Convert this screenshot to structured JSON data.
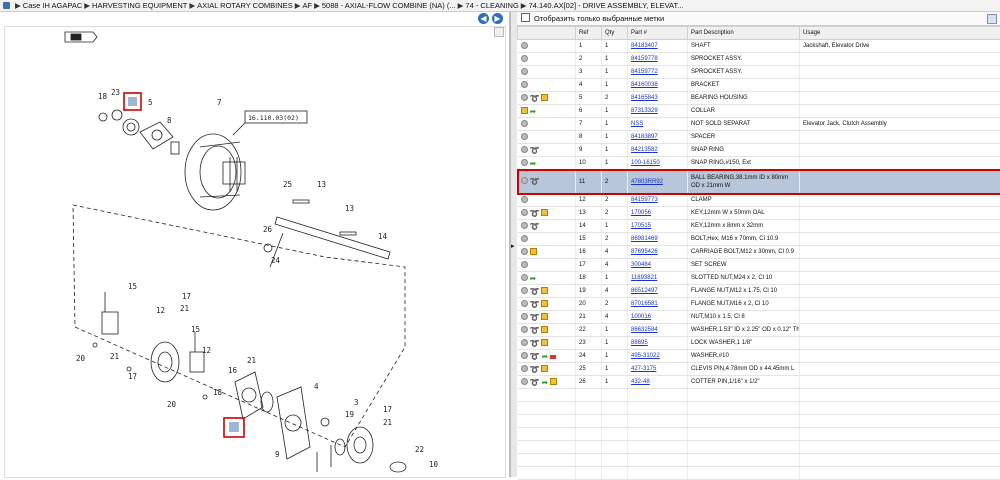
{
  "breadcrumb": [
    "Case IH AGAPAC",
    "HARVESTING EQUIPMENT",
    "AXIAL ROTARY COMBINES",
    "AF",
    "5088 - AXIAL-FLOW COMBINE (NA) (...",
    "74 - CLEANING",
    "74.140.AX[02] - DRIVE ASSEMBLY, ELEVAT..."
  ],
  "panel": {
    "show_selected_label": "Отобразить только выбранные метки"
  },
  "diagram": {
    "ref_box": "16.110.03(02)",
    "callout": "11"
  },
  "table": {
    "headers": {
      "ref": "Ref",
      "qty": "Qty",
      "part": "Part #",
      "desc": "Part Description",
      "usage": "Usage"
    },
    "rows": [
      {
        "icons": [
          "gear"
        ],
        "ref": "1",
        "qty": "1",
        "part": "84183407",
        "desc": "SHAFT",
        "usage": "Jackshaft, Elevator Drive"
      },
      {
        "icons": [
          "gear"
        ],
        "ref": "2",
        "qty": "1",
        "part": "84159778",
        "desc": "SPROCKET ASSY.",
        "usage": ""
      },
      {
        "icons": [
          "gear"
        ],
        "ref": "3",
        "qty": "1",
        "part": "84159772",
        "desc": "SPROCKET ASSY.",
        "usage": ""
      },
      {
        "icons": [
          "gear"
        ],
        "ref": "4",
        "qty": "1",
        "part": "84160038",
        "desc": "BRACKET",
        "usage": ""
      },
      {
        "icons": [
          "gear",
          "ref",
          "box"
        ],
        "ref": "5",
        "qty": "2",
        "part": "84165843",
        "desc": "BEARING HOUSING",
        "usage": ""
      },
      {
        "icons": [
          "box",
          "swap"
        ],
        "ref": "6",
        "qty": "1",
        "part": "87313329",
        "desc": "COLLAR",
        "usage": ""
      },
      {
        "icons": [
          "gear"
        ],
        "ref": "7",
        "qty": "1",
        "part": "NSS",
        "desc": "NOT SOLD SEPARAT",
        "usage": "Elevator Jack, Clutch Assembly"
      },
      {
        "icons": [
          "gear"
        ],
        "ref": "8",
        "qty": "1",
        "part": "84183897",
        "desc": "SPACER",
        "usage": ""
      },
      {
        "icons": [
          "gear",
          "ref"
        ],
        "ref": "9",
        "qty": "1",
        "part": "84213582",
        "desc": "SNAP RING",
        "usage": ""
      },
      {
        "icons": [
          "gear",
          "swap"
        ],
        "ref": "10",
        "qty": "1",
        "part": "100-16150",
        "desc": "SNAP RING,#150, Ext",
        "usage": ""
      },
      {
        "icons": [
          "gear",
          "ref"
        ],
        "ref": "11",
        "qty": "2",
        "part": "47803RR92",
        "desc": "BALL BEARING,38.1mm ID x 80mm OD x 21mm W",
        "usage": "",
        "highlight": true
      },
      {
        "icons": [
          "gear"
        ],
        "ref": "12",
        "qty": "2",
        "part": "84159773",
        "desc": "CLAMP",
        "usage": ""
      },
      {
        "icons": [
          "gear",
          "ref",
          "box"
        ],
        "ref": "13",
        "qty": "2",
        "part": "170056",
        "desc": "KEY,12mm W x 50mm OAL",
        "usage": ""
      },
      {
        "icons": [
          "gear",
          "ref"
        ],
        "ref": "14",
        "qty": "1",
        "part": "170515",
        "desc": "KEY,12mm x 8mm x 32mm",
        "usage": ""
      },
      {
        "icons": [
          "gear"
        ],
        "ref": "15",
        "qty": "2",
        "part": "86981469",
        "desc": "BOLT,Hex, M16 x 70mm, Cl 10.9",
        "usage": ""
      },
      {
        "icons": [
          "gear",
          "box"
        ],
        "ref": "16",
        "qty": "4",
        "part": "87695426",
        "desc": "CARRIAGE BOLT,M12 x 30mm, Cl 0.9",
        "usage": ""
      },
      {
        "icons": [
          "gear"
        ],
        "ref": "17",
        "qty": "4",
        "part": "300484",
        "desc": "SET SCREW",
        "usage": ""
      },
      {
        "icons": [
          "gear",
          "swap"
        ],
        "ref": "18",
        "qty": "1",
        "part": "11893821",
        "desc": "SLOTTED NUT,M24 x 2, Cl 10",
        "usage": ""
      },
      {
        "icons": [
          "gear",
          "ref",
          "box"
        ],
        "ref": "19",
        "qty": "4",
        "part": "86512497",
        "desc": "FLANGE NUT,M12 x 1.75, Cl 10",
        "usage": ""
      },
      {
        "icons": [
          "gear",
          "ref",
          "box"
        ],
        "ref": "20",
        "qty": "2",
        "part": "87016581",
        "desc": "FLANGE NUT,M16 x 2, Cl 10",
        "usage": ""
      },
      {
        "icons": [
          "gear",
          "ref",
          "box"
        ],
        "ref": "21",
        "qty": "4",
        "part": "100016",
        "desc": "NUT,M10 x 1.5, Cl 8",
        "usage": ""
      },
      {
        "icons": [
          "gear",
          "ref",
          "box"
        ],
        "ref": "22",
        "qty": "1",
        "part": "86632584",
        "desc": "WASHER,1.53\" ID x 2.25\" OD x 0.12\" Thk",
        "usage": ""
      },
      {
        "icons": [
          "gear",
          "ref",
          "box"
        ],
        "ref": "23",
        "qty": "1",
        "part": "88695",
        "desc": "LOCK WASHER,1 1/8\"",
        "usage": ""
      },
      {
        "icons": [
          "gear",
          "ref",
          "swap",
          "flag"
        ],
        "ref": "24",
        "qty": "1",
        "part": "495-31022",
        "desc": "WASHER,#10",
        "usage": ""
      },
      {
        "icons": [
          "gear",
          "ref",
          "box"
        ],
        "ref": "25",
        "qty": "1",
        "part": "427-3175",
        "desc": "CLEVIS PIN,4.78mm OD x 44.45mm L",
        "usage": ""
      },
      {
        "icons": [
          "gear",
          "ref",
          "swap",
          "box"
        ],
        "ref": "26",
        "qty": "1",
        "part": "432-48",
        "desc": "COTTER PIN,1/16\" x 1/2\"",
        "usage": ""
      }
    ]
  }
}
